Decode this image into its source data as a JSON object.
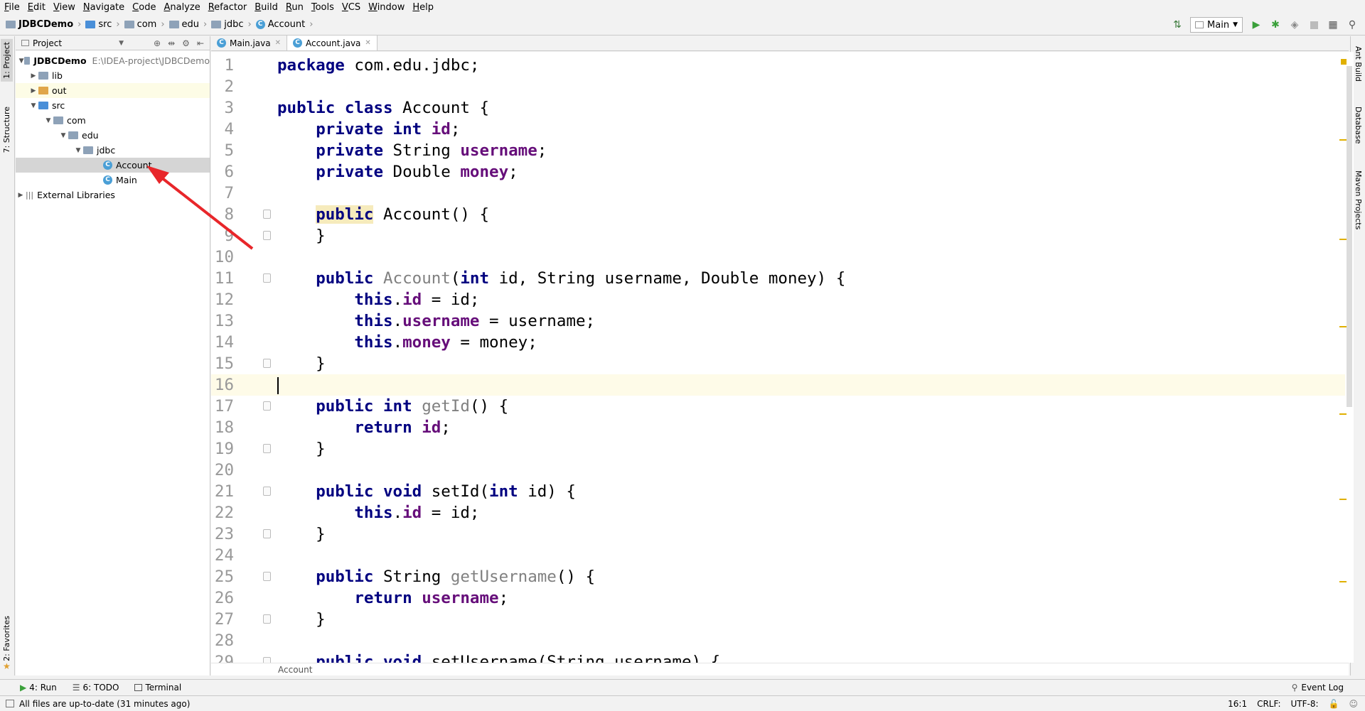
{
  "menu": [
    "File",
    "Edit",
    "View",
    "Navigate",
    "Code",
    "Analyze",
    "Refactor",
    "Build",
    "Run",
    "Tools",
    "VCS",
    "Window",
    "Help"
  ],
  "breadcrumb": [
    "JDBCDemo",
    "src",
    "com",
    "edu",
    "jdbc",
    "Account"
  ],
  "run_config": "Main",
  "left_tabs": [
    "1: Project",
    "7: Structure",
    "2: Favorites"
  ],
  "right_tabs": [
    "Ant Build",
    "Database",
    "Maven Projects"
  ],
  "project": {
    "header": "Project",
    "tree": [
      {
        "label": "JDBCDemo",
        "path": "E:\\IDEA-project\\JDBCDemo"
      },
      {
        "label": "lib"
      },
      {
        "label": "out"
      },
      {
        "label": "src"
      },
      {
        "label": "com"
      },
      {
        "label": "edu"
      },
      {
        "label": "jdbc"
      },
      {
        "label": "Account"
      },
      {
        "label": "Main"
      },
      {
        "label": "External Libraries"
      }
    ]
  },
  "tabs": [
    {
      "label": "Main.java"
    },
    {
      "label": "Account.java"
    }
  ],
  "editor": {
    "line_numbers": [
      "1",
      "2",
      "3",
      "4",
      "5",
      "6",
      "7",
      "8",
      "9",
      "10",
      "11",
      "12",
      "13",
      "14",
      "15",
      "16",
      "17",
      "18",
      "19",
      "20",
      "21",
      "22",
      "23",
      "24",
      "25",
      "26",
      "27",
      "28",
      "29"
    ],
    "current_line": 16,
    "breadcrumb": "Account"
  },
  "toolwindows": {
    "run": "4: Run",
    "todo": "6: TODO",
    "terminal": "Terminal",
    "event_log": "Event Log"
  },
  "status": {
    "message": "All files are up-to-date (31 minutes ago)",
    "position": "16:1",
    "line_sep": "CRLF:",
    "encoding": "UTF-8:"
  },
  "colors": {
    "keyword": "#000080",
    "field": "#660e7a",
    "unused": "#808080",
    "current_line": "#fefbe8",
    "annotation_arrow": "#e8262a"
  }
}
